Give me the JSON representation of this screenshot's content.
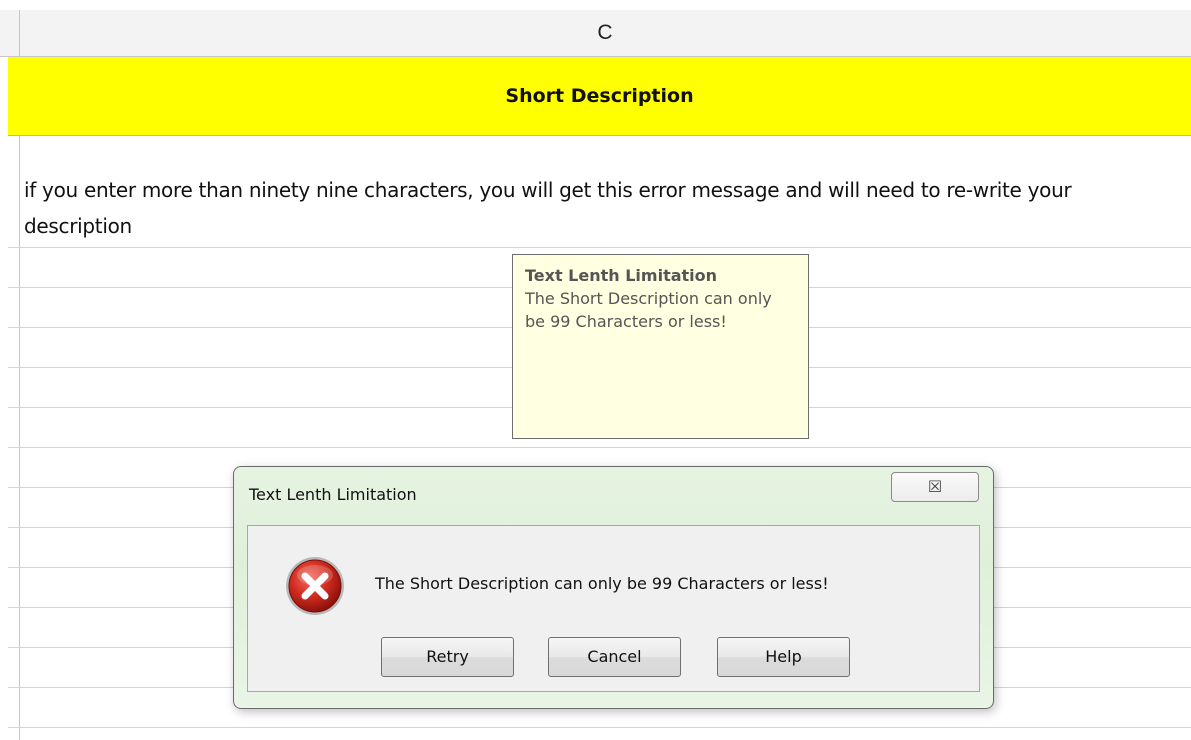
{
  "column_header": {
    "letter": "C"
  },
  "cell_header": {
    "text": "Short Description"
  },
  "cell_content": {
    "text": "if you enter more than ninety nine characters, you will get this error message and will need to re-write your description"
  },
  "input_message": {
    "title": "Text Lenth Limitation",
    "body": "The Short Description can only be 99 Characters or less!"
  },
  "dialog": {
    "title": "Text Lenth Limitation",
    "close_glyph": "☒",
    "message": "The Short Description can only be 99 Characters or less!",
    "icon": "error-icon",
    "buttons": {
      "retry": "Retry",
      "cancel": "Cancel",
      "help": "Help"
    }
  },
  "colors": {
    "header_fill": "#ffff00",
    "tooltip_fill": "#ffffe1",
    "dialog_frame": "#dff0da",
    "error_red": "#c8201c"
  }
}
